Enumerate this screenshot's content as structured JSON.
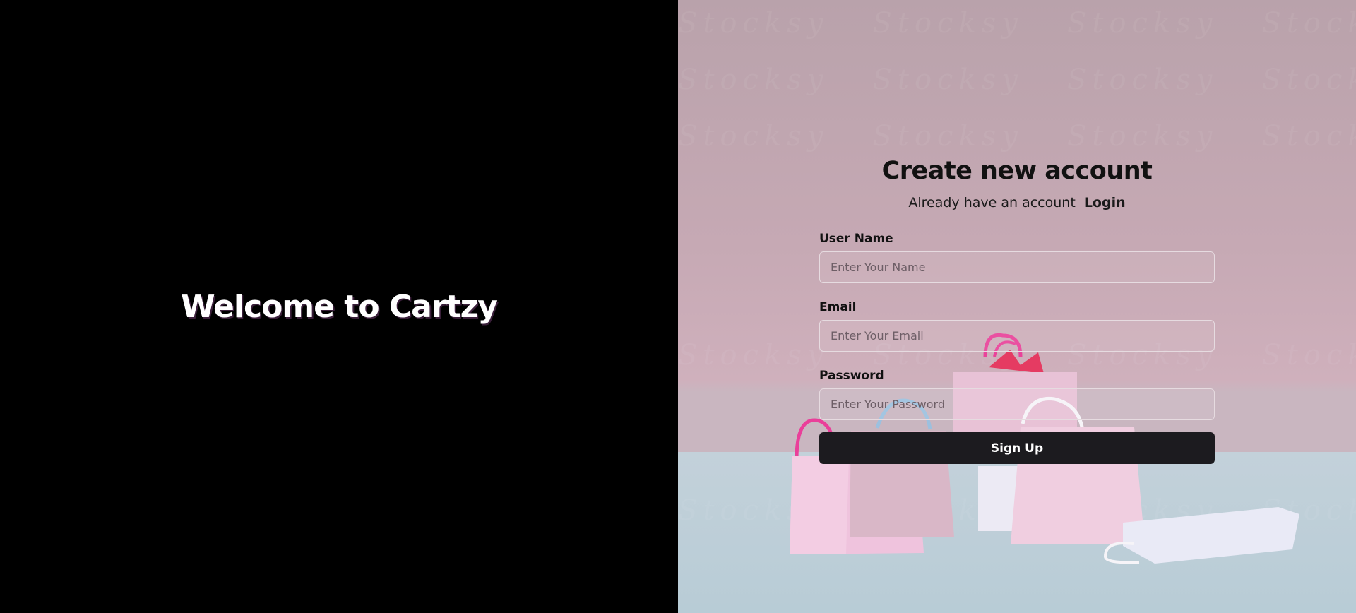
{
  "left": {
    "welcome_title": "Welcome to Cartzy"
  },
  "form": {
    "title": "Create new account",
    "subtitle_text": "Already have an account",
    "login_link": "Login",
    "fields": [
      {
        "label": "User Name",
        "placeholder": "Enter Your Name"
      },
      {
        "label": "Email",
        "placeholder": "Enter Your Email"
      },
      {
        "label": "Password",
        "placeholder": "Enter Your Password"
      }
    ],
    "submit_label": "Sign Up"
  },
  "background": {
    "watermark_text": "Stocksy",
    "colors": {
      "left_panel": "#000000",
      "wall": "#c6a9b4",
      "floor": "#bccdd7",
      "button": "#1c1b1f"
    }
  }
}
